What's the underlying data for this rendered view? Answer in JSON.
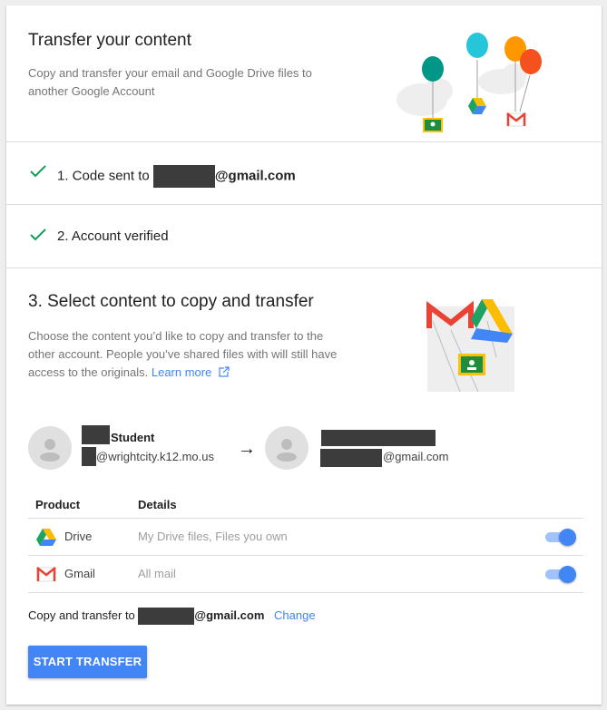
{
  "header": {
    "title": "Transfer your content",
    "subtitle": "Copy and transfer your email and Google Drive files to another Google Account"
  },
  "steps": [
    {
      "label": "1. Code sent to ",
      "email_suffix": "@gmail.com",
      "icon": "check-icon"
    },
    {
      "label": "2. Account verified",
      "icon": "check-icon"
    }
  ],
  "select_section": {
    "title": "3. Select content to copy and transfer",
    "description": "Choose the content you’d like to copy and transfer to the other account. People you’ve shared files with will still have access to the originals. ",
    "learn_more": "Learn more",
    "learn_more_icon": "external-link-icon"
  },
  "source_account": {
    "name": "Student",
    "email": "@wrightcity.k12.mo.us"
  },
  "arrow": "→",
  "dest_account": {
    "email": "@gmail.com"
  },
  "table": {
    "headers": [
      "Product",
      "Details"
    ],
    "rows": [
      {
        "product": "Drive",
        "details": "My Drive files, Files you own",
        "enabled": true,
        "icon": "google-drive-icon"
      },
      {
        "product": "Gmail",
        "details": "All mail",
        "enabled": true,
        "icon": "gmail-icon"
      }
    ]
  },
  "destination_line": {
    "prefix": "Copy and transfer to ",
    "email_suffix": "@gmail.com",
    "change": "Change"
  },
  "start_button": "START TRANSFER",
  "colors": {
    "accent": "#4285f4",
    "check": "#0f9d58",
    "toggle_track": "#a1c2fa"
  }
}
